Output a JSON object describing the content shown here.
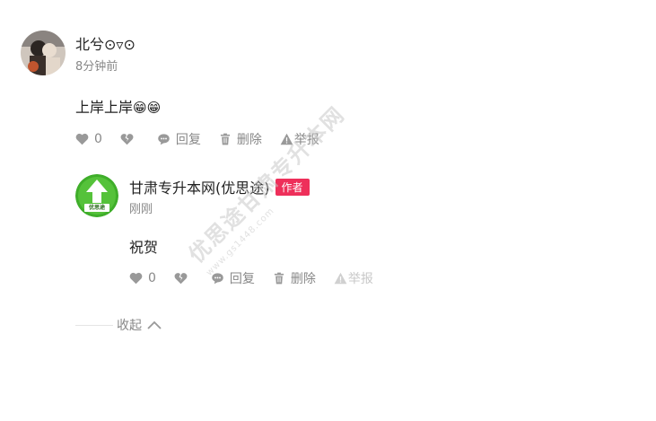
{
  "comment": {
    "author": "北兮⊙▿⊙",
    "time": "8分钟前",
    "content": "上岸上岸",
    "emoji": "😁😁",
    "likes": "0",
    "reply_label": "回复",
    "delete_label": "删除",
    "report_label": "举报"
  },
  "reply": {
    "author": "甘肃专升本网(优思途)",
    "author_badge": "作者",
    "time": "刚刚",
    "content": "祝贺",
    "likes": "0",
    "reply_label": "回复",
    "delete_label": "删除",
    "report_label": "举报",
    "avatar_text": "优思途"
  },
  "collapse_label": "收起",
  "watermark": {
    "text": "优思途甘肃专升本网",
    "url": "www.gs1448.com"
  },
  "colors": {
    "badge": "#ee2f5a",
    "avatar_green": "#3fae2a"
  }
}
